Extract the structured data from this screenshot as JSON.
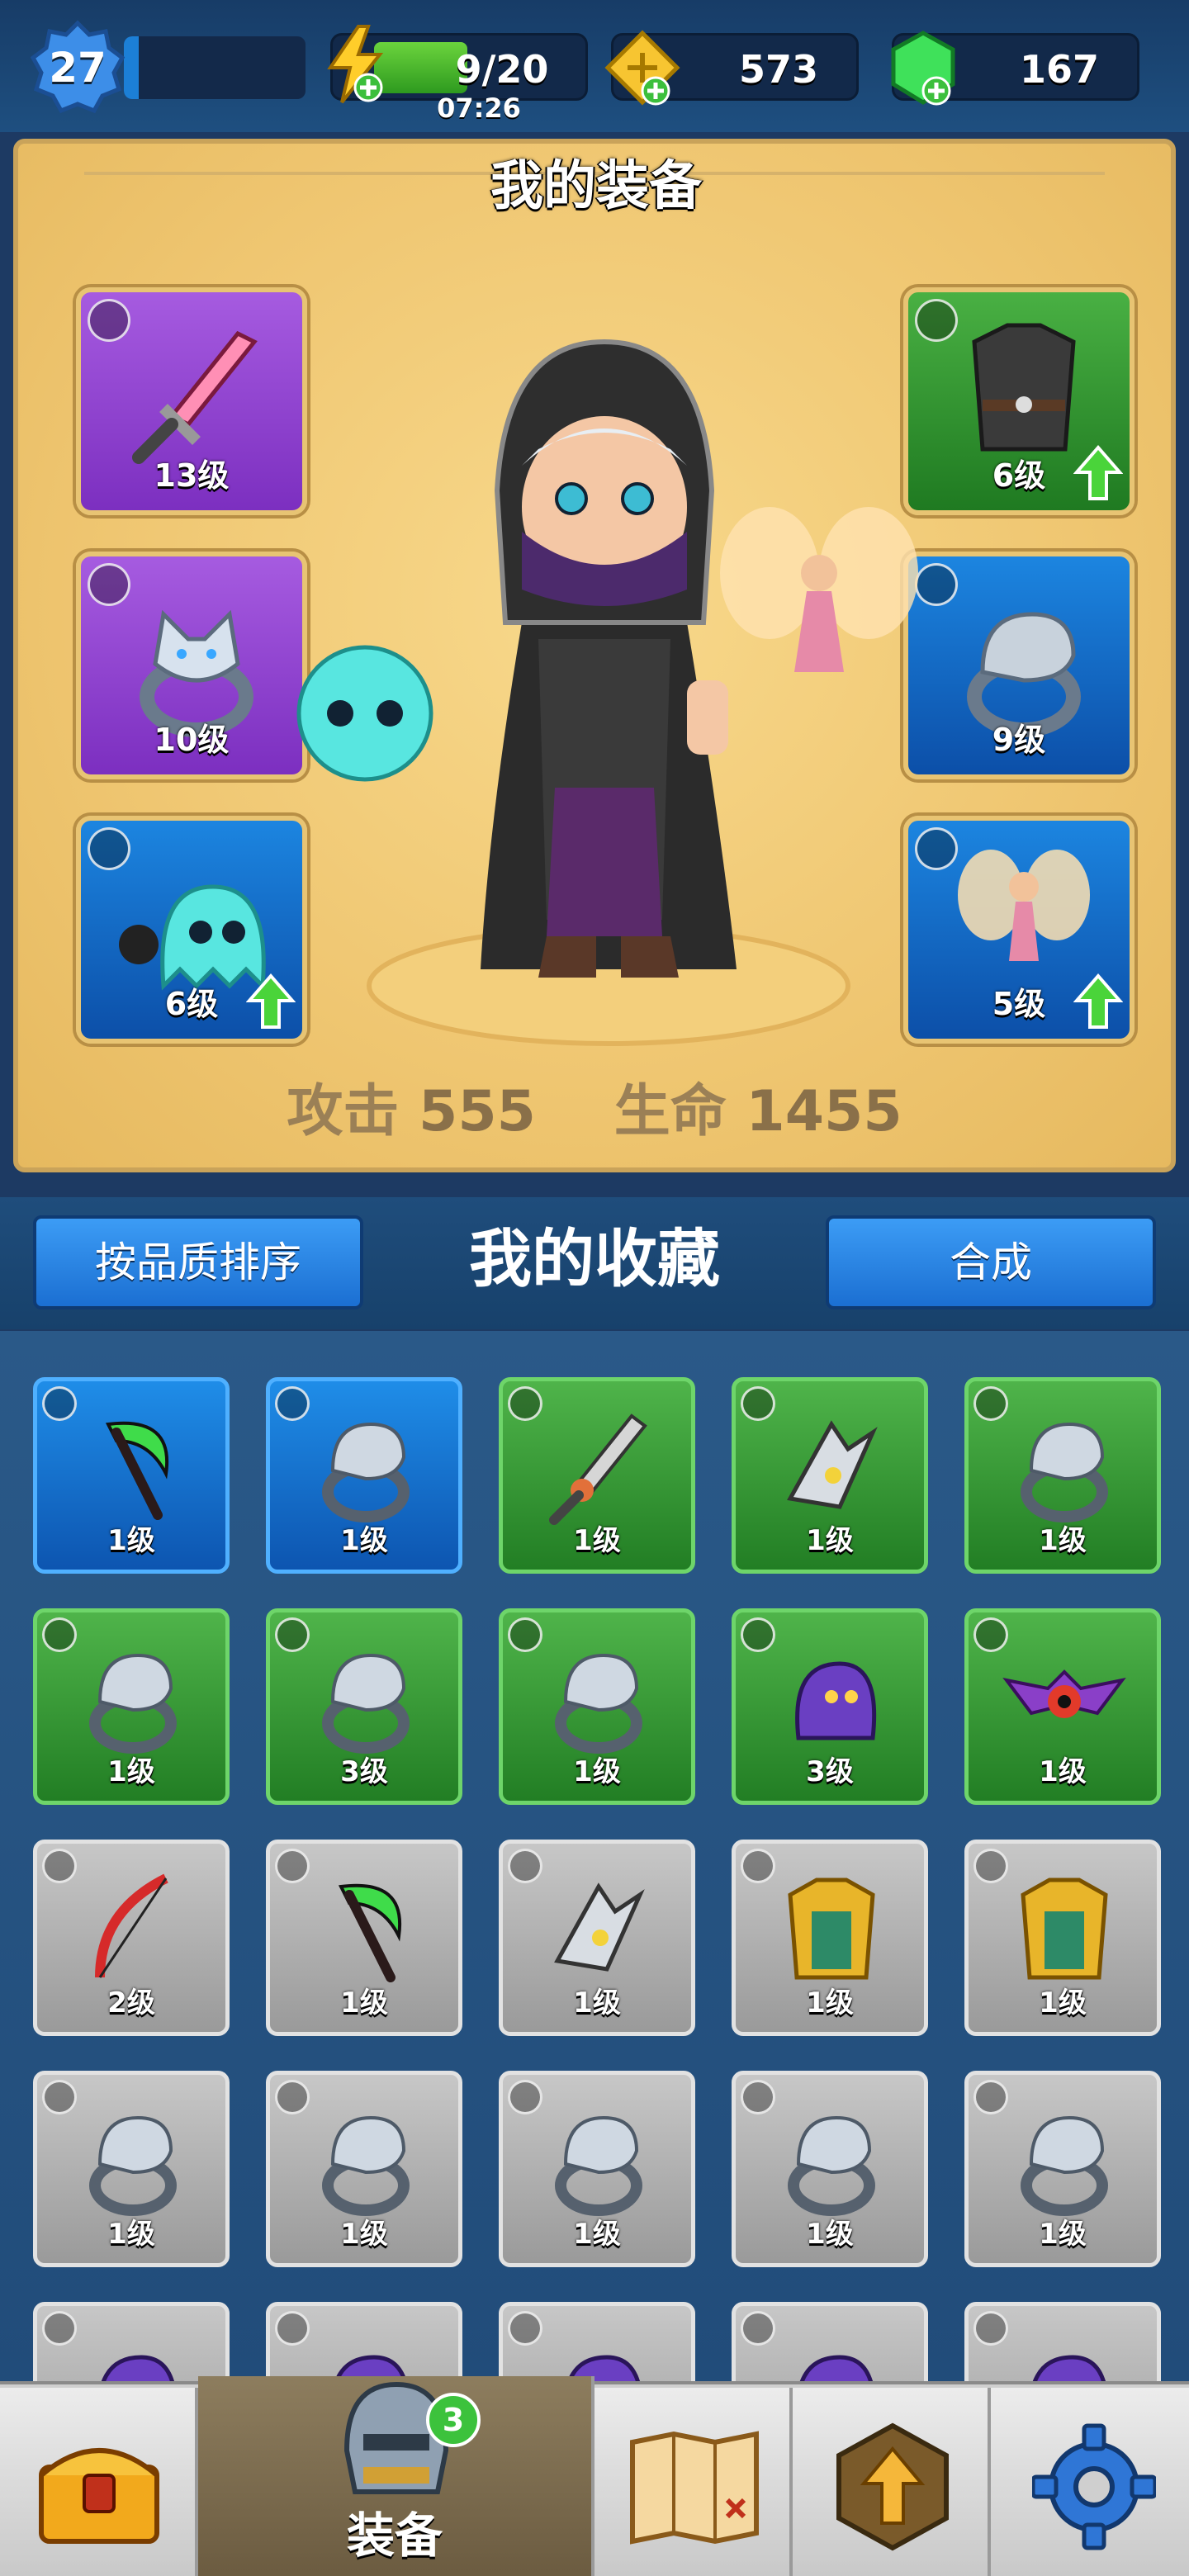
{
  "topbar": {
    "level": "27",
    "energy": "9/20",
    "energy_timer": "07:26",
    "gold": "573",
    "gems": "167",
    "xp_fraction": 0.08,
    "energy_fraction": 0.45
  },
  "equipment": {
    "title": "我的装备",
    "left_slots": [
      {
        "level": "13级",
        "rarity": "purple",
        "type": "weapon-icon"
      },
      {
        "level": "10级",
        "rarity": "purple",
        "type": "ring-icon"
      },
      {
        "level": "6级",
        "rarity": "blue",
        "type": "pet-icon",
        "upgrade": true
      }
    ],
    "right_slots": [
      {
        "level": "6级",
        "rarity": "green",
        "type": "armor-icon",
        "upgrade": true
      },
      {
        "level": "9级",
        "rarity": "blue",
        "type": "ring-icon"
      },
      {
        "level": "5级",
        "rarity": "blue",
        "type": "pet-icon",
        "upgrade": true
      }
    ],
    "attack_label": "攻击",
    "attack_value": "555",
    "hp_label": "生命",
    "hp_value": "1455"
  },
  "collection": {
    "sort_button": "按品质排序",
    "title": "我的收藏",
    "merge_button": "合成"
  },
  "grid": [
    [
      {
        "level": "1级",
        "rarity": "blue",
        "item": "scythe"
      },
      {
        "level": "1级",
        "rarity": "blue",
        "item": "ring"
      },
      {
        "level": "1级",
        "rarity": "green",
        "item": "sword"
      },
      {
        "level": "1级",
        "rarity": "green",
        "item": "shuriken"
      },
      {
        "level": "1级",
        "rarity": "green",
        "item": "ring"
      }
    ],
    [
      {
        "level": "1级",
        "rarity": "green",
        "item": "ring"
      },
      {
        "level": "3级",
        "rarity": "green",
        "item": "ring"
      },
      {
        "level": "1级",
        "rarity": "green",
        "item": "ring"
      },
      {
        "level": "3级",
        "rarity": "green",
        "item": "pet"
      },
      {
        "level": "1级",
        "rarity": "green",
        "item": "bat"
      }
    ],
    [
      {
        "level": "2级",
        "rarity": "grey",
        "item": "bow"
      },
      {
        "level": "1级",
        "rarity": "grey",
        "item": "scythe"
      },
      {
        "level": "1级",
        "rarity": "grey",
        "item": "shuriken"
      },
      {
        "level": "1级",
        "rarity": "grey",
        "item": "armor"
      },
      {
        "level": "1级",
        "rarity": "grey",
        "item": "armor"
      }
    ],
    [
      {
        "level": "1级",
        "rarity": "grey",
        "item": "ring"
      },
      {
        "level": "1级",
        "rarity": "grey",
        "item": "ring"
      },
      {
        "level": "1级",
        "rarity": "grey",
        "item": "ring"
      },
      {
        "level": "1级",
        "rarity": "grey",
        "item": "ring"
      },
      {
        "level": "1级",
        "rarity": "grey",
        "item": "ring"
      }
    ],
    [
      {
        "level": "",
        "rarity": "grey",
        "item": "pet"
      },
      {
        "level": "",
        "rarity": "grey",
        "item": "pet"
      },
      {
        "level": "",
        "rarity": "grey",
        "item": "pet"
      },
      {
        "level": "",
        "rarity": "grey",
        "item": "pet"
      },
      {
        "level": "",
        "rarity": "grey",
        "item": "pet"
      }
    ]
  ],
  "nav": {
    "equipment_label": "装备",
    "equipment_badge": "3"
  },
  "colors": {
    "panel": "#efc671",
    "purple": "#8d3fd0",
    "green": "#2e8f2c",
    "blue": "#1266c2",
    "grey": "#a8a8a8"
  }
}
